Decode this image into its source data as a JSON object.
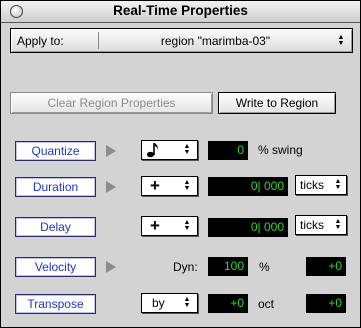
{
  "window": {
    "title": "Real-Time Properties"
  },
  "apply": {
    "label": "Apply to:",
    "value": "region \"marimba-03\""
  },
  "buttons": {
    "clear": "Clear Region Properties",
    "write": "Write to Region"
  },
  "rows": {
    "quantize": {
      "label": "Quantize",
      "value": "0",
      "unit": "% swing",
      "popup_icon": "eighth-note-icon"
    },
    "duration": {
      "label": "Duration",
      "op": "+",
      "value": "0| 000",
      "unit": "ticks"
    },
    "delay": {
      "label": "Delay",
      "op": "+",
      "value": "0| 000",
      "unit": "ticks"
    },
    "velocity": {
      "label": "Velocity",
      "dyn_label": "Dyn:",
      "dyn_value": "100",
      "dyn_unit": "%",
      "offset": "+0"
    },
    "transpose": {
      "label": "Transpose",
      "mode": "by",
      "value": "+0",
      "unit": "oct",
      "offset": "+0"
    }
  },
  "colors": {
    "lcd_bg": "#000000",
    "lcd_text": "#2dd82d",
    "row_button_text": "#1d35cc"
  }
}
